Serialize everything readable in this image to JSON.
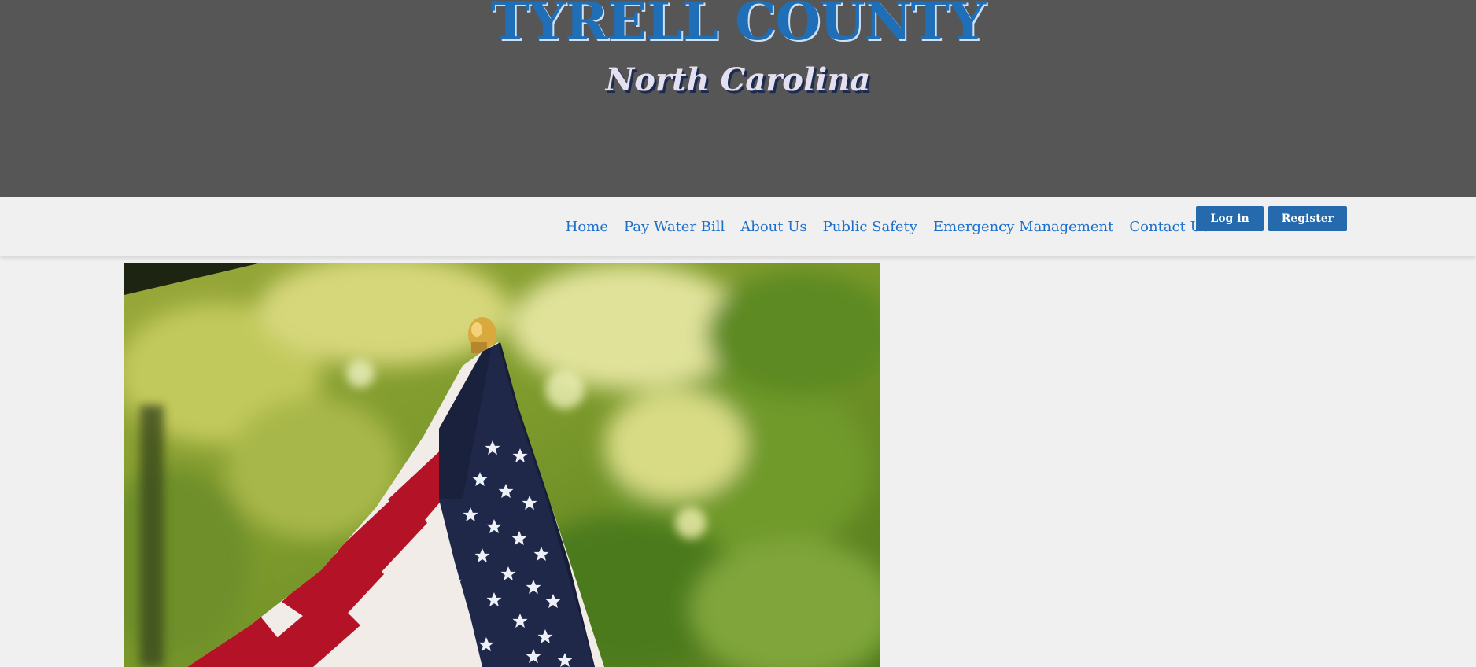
{
  "site": {
    "title": "TYRELL COUNTY",
    "subtitle": "North Carolina"
  },
  "nav": {
    "links": [
      "Home",
      "Pay Water Bill",
      "About Us",
      "Public Safety",
      "Emergency Management",
      "Contact Us"
    ],
    "login_label": "Log in",
    "register_label": "Register"
  },
  "colors": {
    "banner": "#565656",
    "title": "#1f6fb8",
    "link": "#1c6fcd",
    "button": "#246aad",
    "page_background": "#f0f0f0"
  },
  "hero": {
    "image": "american-flag-on-pole-with-green-foliage"
  }
}
